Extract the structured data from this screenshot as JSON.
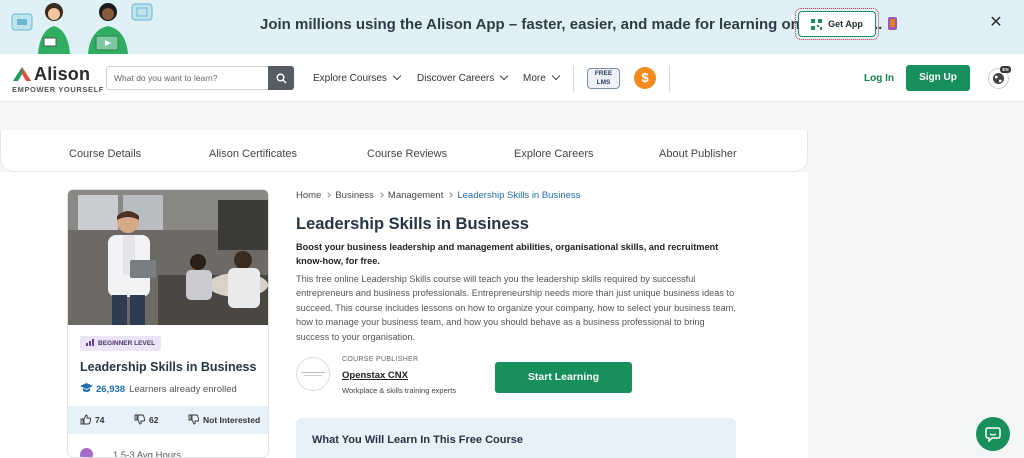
{
  "banner": {
    "text": "Join millions using the Alison App – faster, easier, and made for learning on the move...",
    "get_app_label": "Get App",
    "close_symbol": "✕"
  },
  "header": {
    "logo_name": "Alison",
    "logo_tagline": "EMPOWER YOURSELF",
    "search_placeholder": "What do you want to learn?",
    "nav": {
      "explore_courses": "Explore Courses",
      "discover_careers": "Discover Careers",
      "more": "More"
    },
    "free_lms_line1": "FREE",
    "free_lms_line2": "LMS",
    "coin_symbol": "$",
    "login_label": "Log In",
    "signup_label": "Sign Up",
    "language_badge": "EN"
  },
  "subnav": {
    "items": [
      "Course Details",
      "Alison Certificates",
      "Course Reviews",
      "Explore Careers",
      "About Publisher"
    ]
  },
  "card": {
    "level": "BEGINNER LEVEL",
    "title": "Leadership Skills in Business",
    "enrolled_count": "26,938",
    "enrolled_label": "Learners already enrolled",
    "likes": "74",
    "dislikes": "62",
    "not_interested": "Not Interested",
    "hours": "1.5-3 Avg Hours"
  },
  "breadcrumb": {
    "items": [
      "Home",
      "Business",
      "Management",
      "Leadership Skills in Business"
    ]
  },
  "course": {
    "title": "Leadership Skills in Business",
    "lead": "Boost your business leadership and management abilities, organisational skills, and recruitment know-how, for free.",
    "description": "This free online Leadership Skills course will teach you the leadership skills required by successful entrepreneurs and business professionals. Entrepreneurship needs more than just unique business ideas to succeed. This course includes lessons on how to organize your company, how to select your business team, how to manage your business team, and how you should behave as a business professional to bring success to your organisation."
  },
  "publisher": {
    "label": "COURSE PUBLISHER",
    "name": "Openstax CNX",
    "subtitle": "Workplace & skills training experts"
  },
  "cta": {
    "start_learning": "Start Learning"
  },
  "learn_section": {
    "title": "What You Will Learn In This Free Course"
  },
  "colors": {
    "brand_green": "#17905b",
    "banner_bg": "#dff1f6",
    "link_blue": "#1f6fb0"
  }
}
